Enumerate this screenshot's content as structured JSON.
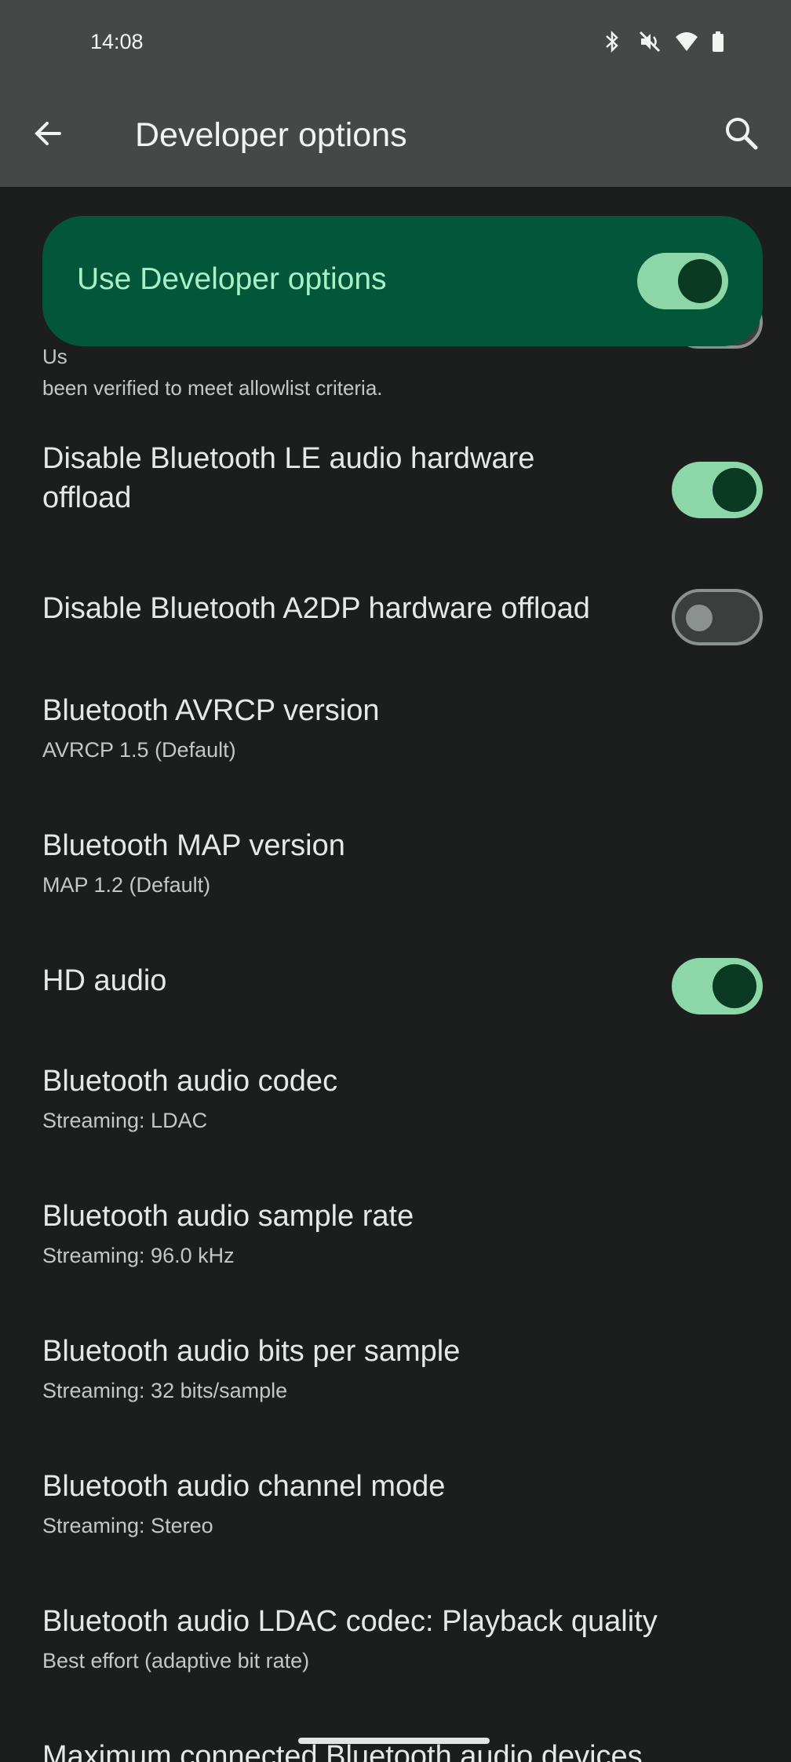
{
  "status_bar": {
    "time": "14:08",
    "icons": [
      "bluetooth-icon",
      "mute-icon",
      "wifi-icon",
      "battery-icon"
    ]
  },
  "app_bar": {
    "title": "Developer options",
    "back_icon": "arrow-back-icon",
    "search_icon": "search-icon"
  },
  "master_switch": {
    "label": "Use Developer options",
    "checked": true
  },
  "partial_item": {
    "subtitle_visible": "been verified to meet allowlist criteria.",
    "partial_prefix": "Us"
  },
  "settings": [
    {
      "label": "Disable Bluetooth LE audio hardware offload",
      "toggle": "on"
    },
    {
      "label": "Disable Bluetooth A2DP hardware offload",
      "toggle": "off"
    },
    {
      "label": "Bluetooth AVRCP version",
      "subtitle": "AVRCP 1.5 (Default)"
    },
    {
      "label": "Bluetooth MAP version",
      "subtitle": "MAP 1.2 (Default)"
    },
    {
      "label": "HD audio",
      "toggle": "on"
    },
    {
      "label": "Bluetooth audio codec",
      "subtitle": "Streaming: LDAC"
    },
    {
      "label": "Bluetooth audio sample rate",
      "subtitle": "Streaming: 96.0 kHz"
    },
    {
      "label": "Bluetooth audio bits per sample",
      "subtitle": "Streaming: 32 bits/sample"
    },
    {
      "label": "Bluetooth audio channel mode",
      "subtitle": "Streaming: Stereo"
    },
    {
      "label": "Bluetooth audio LDAC codec: Playback quality",
      "subtitle": "Best effort (adaptive bit rate)"
    },
    {
      "label": "Maximum connected Bluetooth audio devices"
    }
  ],
  "colors": {
    "background": "#1b1e1d",
    "app_bar": "#444846",
    "banner": "#02563a",
    "toggle_on": "#8dd6a8",
    "toggle_knob": "#0b3a23"
  }
}
